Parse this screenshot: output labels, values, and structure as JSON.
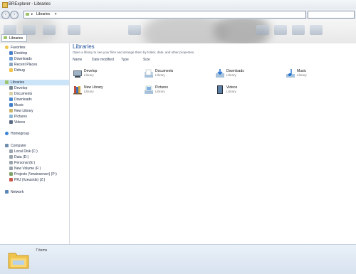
{
  "window": {
    "title": "BRExplorer - Libraries"
  },
  "address": {
    "path": "Libraries",
    "separator": "▸",
    "dropdown": "▾",
    "search_placeholder": ""
  },
  "ribbon": {
    "tab_label": "Libraries"
  },
  "content": {
    "heading": "Libraries",
    "subtext": "Open a library to see your files and arrange them by folder, date, and other properties.",
    "columns": [
      "Name",
      "Date modified",
      "Type",
      "Size"
    ],
    "items": [
      {
        "name": "Develop",
        "type": "Library",
        "icon": "develop-library-icon"
      },
      {
        "name": "Documents",
        "type": "Library",
        "icon": "documents-library-icon"
      },
      {
        "name": "Downloads",
        "type": "Library",
        "icon": "downloads-library-icon"
      },
      {
        "name": "Music",
        "type": "Library",
        "icon": "music-library-icon"
      },
      {
        "name": "New Library",
        "type": "Library",
        "icon": "new-library-icon"
      },
      {
        "name": "Pictures",
        "type": "Library",
        "icon": "pictures-library-icon"
      },
      {
        "name": "Videos",
        "type": "Library",
        "icon": "videos-library-icon"
      }
    ]
  },
  "sidebar": {
    "favorites": {
      "label": "Favorites",
      "items": [
        "Desktop",
        "Downloads",
        "Recent Places",
        "Debug"
      ]
    },
    "libraries": {
      "label": "Libraries",
      "items": [
        "Develop",
        "Documents",
        "Downloads",
        "Music",
        "New Library",
        "Pictures",
        "Videos"
      ]
    },
    "homegroup": {
      "label": "Homegroup"
    },
    "computer": {
      "label": "Computer",
      "items": [
        "Local Disk (C:)",
        "Data (D:)",
        "Personal (E:)",
        "New Volume (F:)",
        "Projects (\\\\mainserver) (P:)",
        "PRJ (\\\\zeus\\ds) (Z:)"
      ]
    },
    "network": {
      "label": "Network"
    }
  },
  "status": {
    "count_text": "7 items"
  },
  "colors": {
    "accent": "#1e4f9a",
    "selection": "#cce4f7",
    "folder": "#f0c44c"
  }
}
